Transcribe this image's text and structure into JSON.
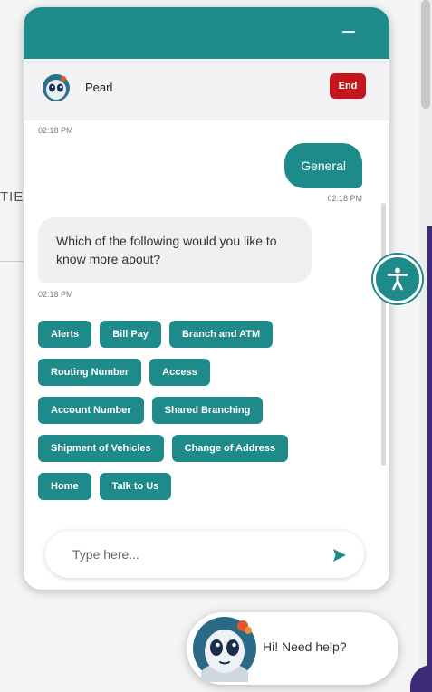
{
  "backdrop": {
    "partial_text": "TIE"
  },
  "colors": {
    "brand_teal": "#1f8a8a",
    "end_red": "#c4161c",
    "accent_purple": "#3d2b7a"
  },
  "chat": {
    "agent_name": "Pearl",
    "end_label": "End",
    "minimize_icon": "minimize-icon",
    "messages": {
      "ts_1": "02:18 PM",
      "user_text": "General",
      "ts_2": "02:18 PM",
      "bot_text": "Which of the following would you like to know more about?",
      "ts_3": "02:18 PM"
    },
    "options": [
      [
        "Alerts",
        "Bill Pay",
        "Branch and ATM"
      ],
      [
        "Routing Number",
        "Access"
      ],
      [
        "Account Number",
        "Shared Branching"
      ],
      [
        "Shipment of Vehicles",
        "Change of Address"
      ],
      [
        "Home",
        "Talk to Us"
      ]
    ],
    "composer": {
      "placeholder": "Type here...",
      "send_icon": "send-icon"
    }
  },
  "accessibility": {
    "icon": "accessibility-icon"
  },
  "launcher": {
    "text": "Hi! Need help?"
  }
}
